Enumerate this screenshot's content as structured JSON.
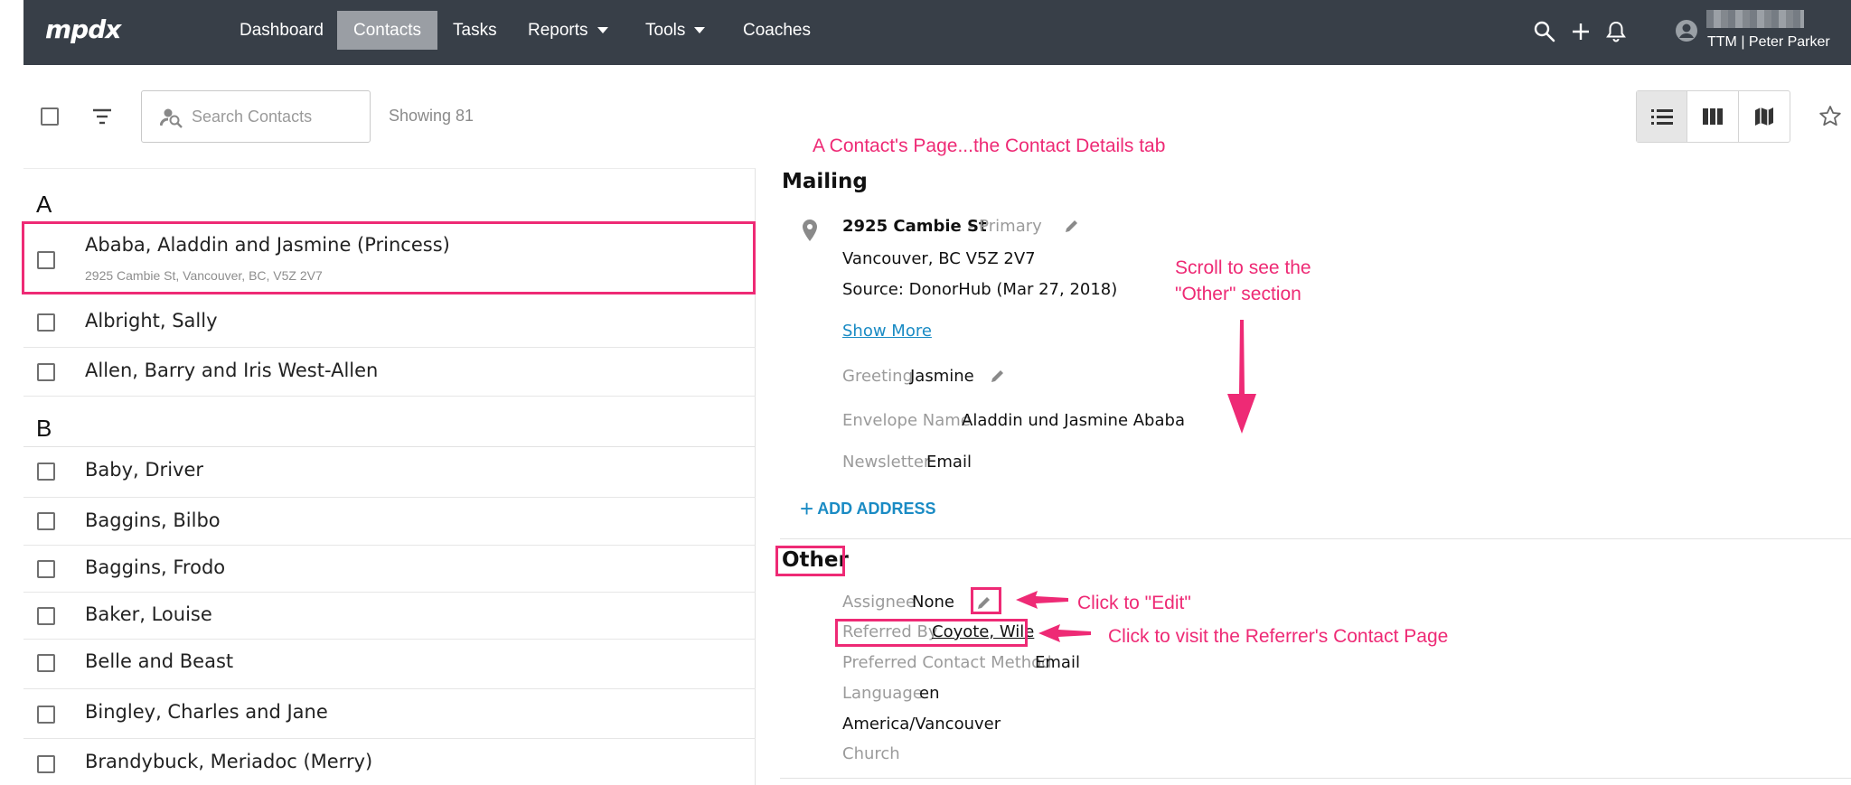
{
  "nav": {
    "logo": "mpdx",
    "items": [
      {
        "label": "Dashboard"
      },
      {
        "label": "Contacts",
        "active": true
      },
      {
        "label": "Tasks"
      },
      {
        "label": "Reports",
        "dropdown": true
      },
      {
        "label": "Tools",
        "dropdown": true
      },
      {
        "label": "Coaches"
      }
    ],
    "user_name": "TTM | Peter Parker"
  },
  "toolbar": {
    "search_placeholder": "Search Contacts",
    "showing_text": "Showing 81"
  },
  "annotations": {
    "page_caption": "A Contact's Page...the Contact Details tab",
    "scroll_note_line1": "Scroll to see the",
    "scroll_note_line2": "\"Other\" section",
    "click_edit": "Click to \"Edit\"",
    "click_referrer": "Click to visit the Referrer's Contact Page"
  },
  "contacts": {
    "group_a": "A",
    "group_b": "B",
    "items": [
      {
        "name": "Ababa, Aladdin and Jasmine (Princess)",
        "address": "2925 Cambie St, Vancouver, BC, V5Z 2V7"
      },
      {
        "name": "Albright, Sally"
      },
      {
        "name": "Allen, Barry and Iris West-Allen"
      },
      {
        "name": "Baby, Driver"
      },
      {
        "name": "Baggins, Bilbo"
      },
      {
        "name": "Baggins, Frodo"
      },
      {
        "name": "Baker, Louise"
      },
      {
        "name": "Belle and Beast"
      },
      {
        "name": "Bingley, Charles and Jane"
      },
      {
        "name": "Brandybuck, Meriadoc (Merry)"
      }
    ]
  },
  "detail": {
    "mailing_title": "Mailing",
    "street": "2925 Cambie St",
    "primary_tag": "- Primary",
    "city_line": "Vancouver, BC V5Z 2V7",
    "source_line": "Source: DonorHub (Mar 27, 2018)",
    "show_more": "Show More",
    "greeting_label": "Greeting",
    "greeting_value": "Jasmine",
    "envelope_label": "Envelope Name",
    "envelope_value": "Aladdin und Jasmine Ababa",
    "newsletter_label": "Newsletter",
    "newsletter_value": "Email",
    "add_address": "ADD ADDRESS",
    "other_title": "Other",
    "assignee_label": "Assignee",
    "assignee_value": "None",
    "referred_label": "Referred By",
    "referred_value": "Coyote, Wile",
    "pref_contact_label": "Preferred Contact Method",
    "pref_contact_value": "Email",
    "language_label": "Language",
    "language_value": "en",
    "timezone_value": "America/Vancouver",
    "church_label": "Church"
  },
  "colors": {
    "topbar": "#383f48",
    "annotation": "#ee2a75",
    "link": "#1a8bc4"
  }
}
